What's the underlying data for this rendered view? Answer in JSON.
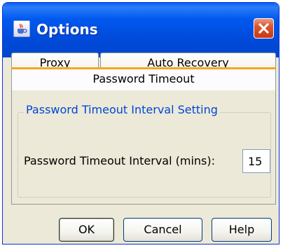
{
  "window": {
    "title": "Options",
    "app_icon": "java-cup-icon",
    "close_icon": "close-icon"
  },
  "tabs": [
    {
      "label": "Proxy",
      "selected": false
    },
    {
      "label": "Auto Recovery",
      "selected": false
    },
    {
      "label": "Password Timeout",
      "selected": true
    }
  ],
  "group": {
    "title": "Password Timeout Interval Setting",
    "field_label": "Password Timeout Interval (mins):",
    "field_value": "15"
  },
  "buttons": {
    "ok": "OK",
    "cancel": "Cancel",
    "help": "Help"
  },
  "colors": {
    "title_bar": "#0058EE",
    "window_bg": "#ECE9D8",
    "group_title": "#0046D5",
    "active_tab_accent": "#F5A623",
    "close_button": "#D8562E"
  }
}
